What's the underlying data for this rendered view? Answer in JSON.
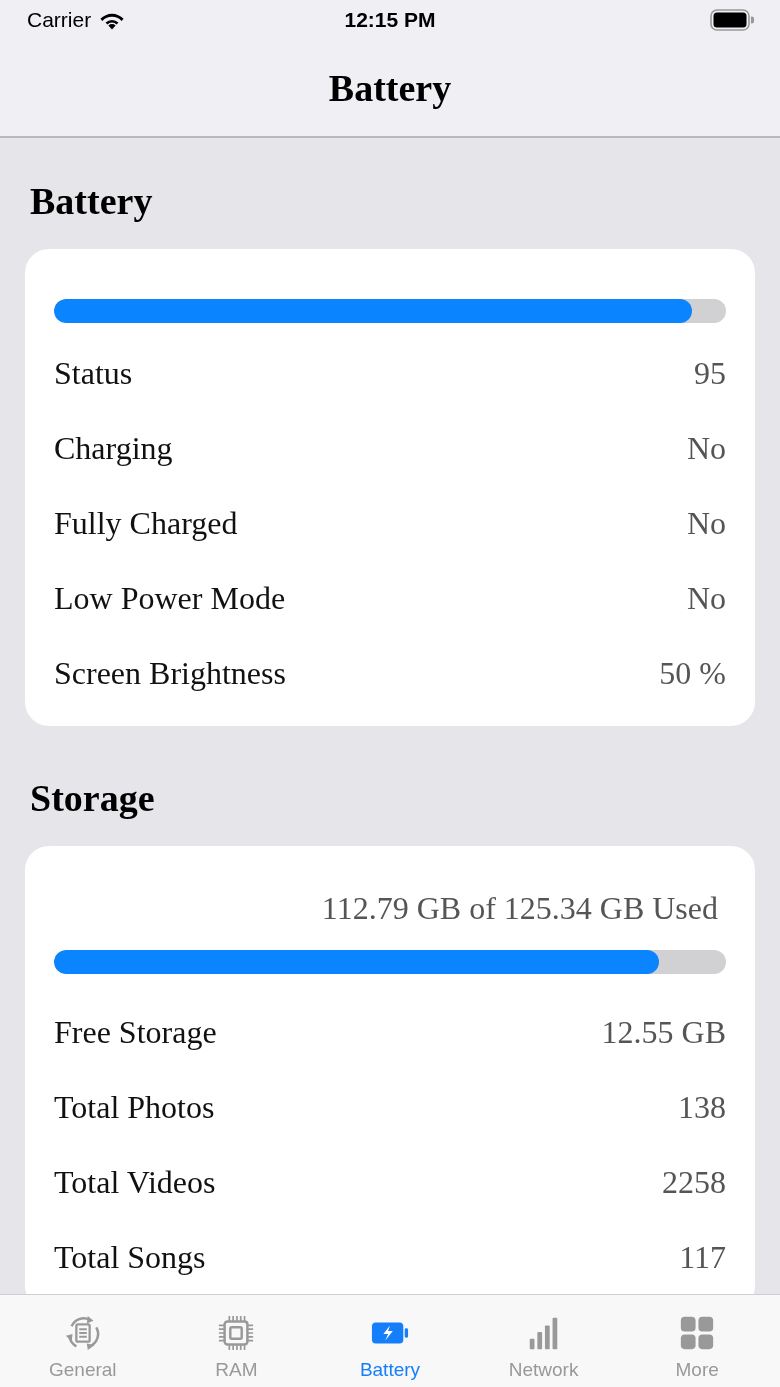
{
  "status_bar": {
    "carrier": "Carrier",
    "time": "12:15 PM"
  },
  "nav_bar": {
    "title": "Battery"
  },
  "sections": [
    {
      "title": "Battery",
      "usage_bar": {
        "level": 0.95
      },
      "rows": [
        {
          "label": "Status",
          "value": "95"
        },
        {
          "label": "Charging",
          "value": "No"
        },
        {
          "label": "Fully Charged",
          "value": "No"
        },
        {
          "label": "Low Power Mode",
          "value": "No"
        },
        {
          "label": "Screen Brightness",
          "value": "50 %"
        }
      ]
    },
    {
      "title": "Storage",
      "usage_text": "112.79 GB of 125.34 GB Used",
      "usage_bar": {
        "level": 0.9
      },
      "rows": [
        {
          "label": "Free Storage",
          "value": "12.55 GB"
        },
        {
          "label": "Total Photos",
          "value": "138"
        },
        {
          "label": "Total Videos",
          "value": "2258"
        },
        {
          "label": "Total Songs",
          "value": "117"
        }
      ]
    }
  ],
  "tab_bar": [
    {
      "label": "General",
      "selected": false
    },
    {
      "label": "RAM",
      "selected": false
    },
    {
      "label": "Battery",
      "selected": true
    },
    {
      "label": "Network",
      "selected": false
    },
    {
      "label": "More",
      "selected": false
    }
  ]
}
